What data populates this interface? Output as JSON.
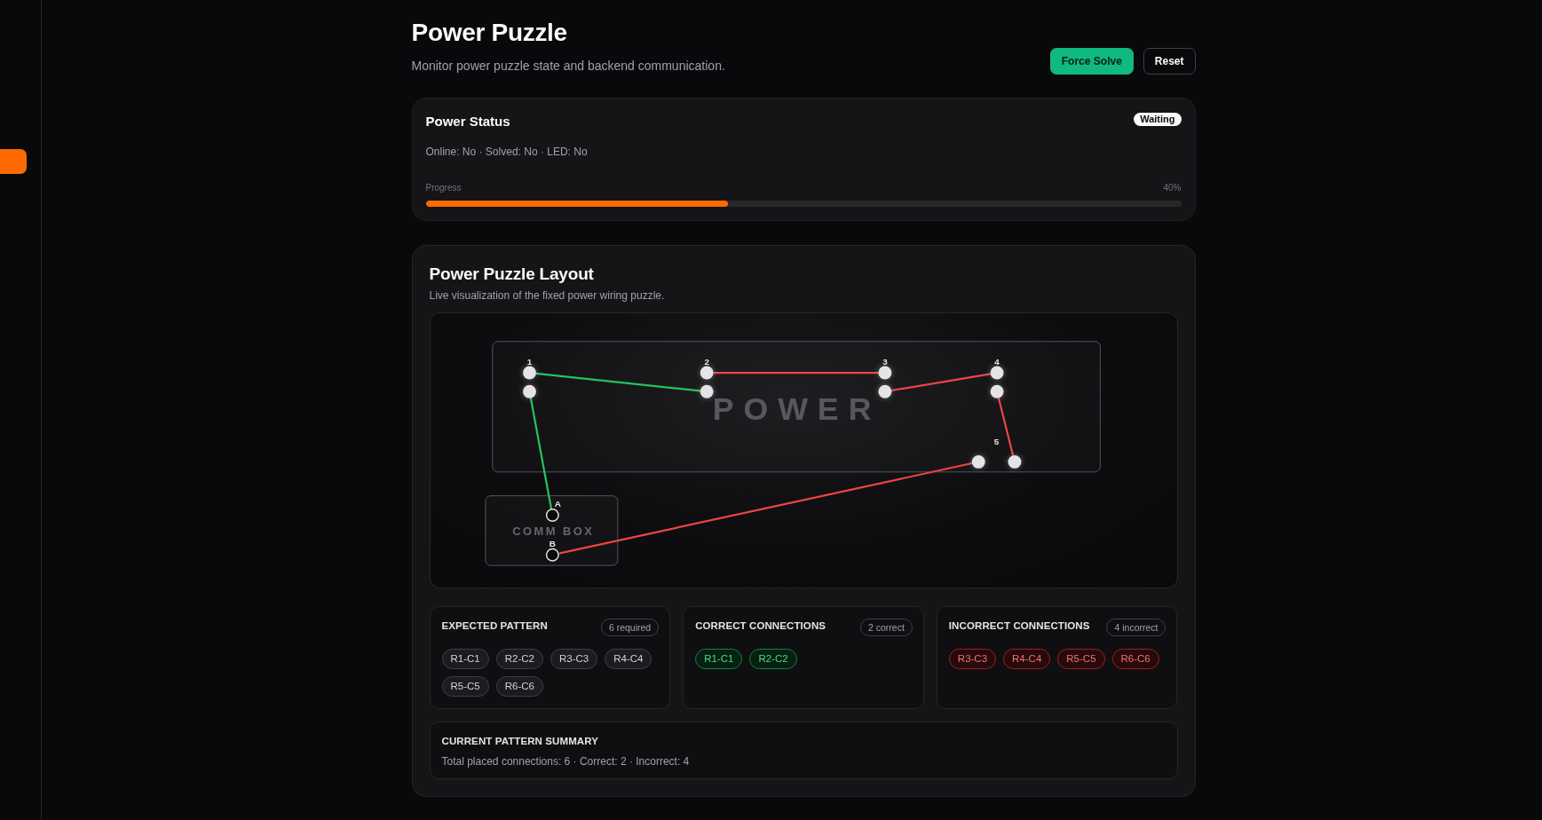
{
  "header": {
    "title": "Power Puzzle",
    "subtitle": "Monitor power puzzle state and backend communication.",
    "buttons": [
      {
        "label": "Force Solve",
        "kind": "primary"
      },
      {
        "label": "Reset",
        "kind": "outline"
      }
    ]
  },
  "status_card": {
    "title": "Power Status",
    "badge": "Waiting",
    "details": "Online: No · Solved: No · LED: No",
    "progress": {
      "label": "Progress",
      "reading": "40%",
      "level": 0.4
    }
  },
  "layout_card": {
    "title": "Power Puzzle Layout",
    "subtitle": "Live visualization of the fixed power wiring puzzle.",
    "diagram": {
      "power_box": {
        "label": "POWER",
        "posts": [
          {
            "label": "1"
          },
          {
            "label": "2"
          },
          {
            "label": "3"
          },
          {
            "label": "4"
          },
          {
            "label": "5"
          }
        ]
      },
      "comm_box": {
        "label": "COMM BOX",
        "ports": [
          {
            "label": "A"
          },
          {
            "label": "B"
          }
        ]
      },
      "wires": [
        {
          "correct": true
        },
        {
          "correct": true
        },
        {
          "correct": false
        },
        {
          "correct": false
        },
        {
          "correct": false
        },
        {
          "correct": false
        }
      ]
    },
    "panels": [
      {
        "title": "EXPECTED PATTERN",
        "count": "6 required",
        "kind": "neutral",
        "chips": [
          "R1-C1",
          "R2-C2",
          "R3-C3",
          "R4-C4",
          "R5-C5",
          "R6-C6"
        ]
      },
      {
        "title": "CORRECT CONNECTIONS",
        "count": "2 correct",
        "kind": "correct",
        "chips": [
          "R1-C1",
          "R2-C2"
        ]
      },
      {
        "title": "INCORRECT CONNECTIONS",
        "count": "4 incorrect",
        "kind": "incorrect",
        "chips": [
          "R3-C3",
          "R4-C4",
          "R5-C5",
          "R6-C6"
        ]
      }
    ],
    "summary": {
      "title": "CURRENT PATTERN SUMMARY",
      "text": "Total placed connections: 6 · Correct: 2 · Incorrect: 4"
    }
  }
}
